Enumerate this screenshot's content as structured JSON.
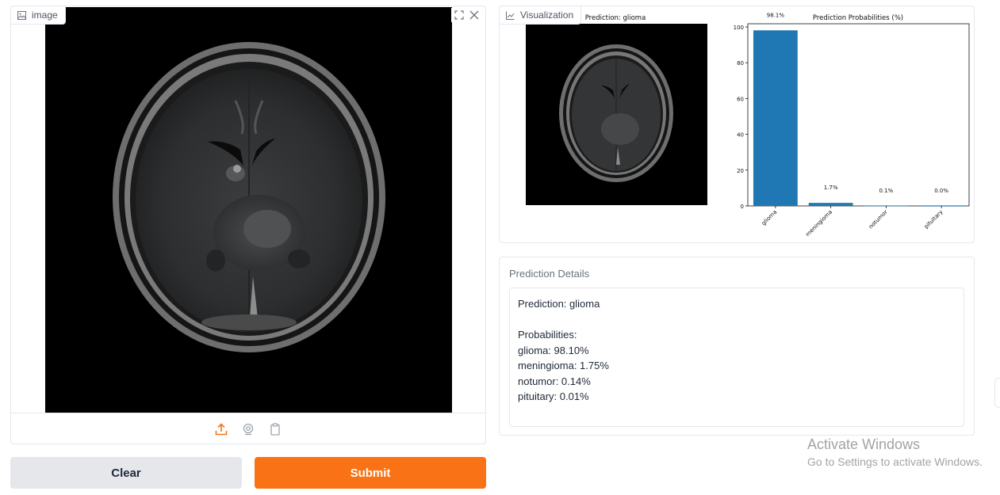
{
  "image_input": {
    "label": "image",
    "icon": "image-icon",
    "toolbar_icons": [
      "upload-icon",
      "webcam-icon",
      "clipboard-icon"
    ],
    "corner_icons": [
      "fullscreen-icon",
      "close-icon"
    ],
    "accent_color": "#f97316"
  },
  "buttons": {
    "clear": "Clear",
    "submit": "Submit"
  },
  "visualization": {
    "label": "Visualization",
    "icon": "chart-icon",
    "image_title": "Prediction: glioma"
  },
  "chart_data": {
    "type": "bar",
    "title": "Prediction Probabilities (%)",
    "categories": [
      "glioma",
      "meningioma",
      "notumor",
      "pituitary"
    ],
    "values": [
      98.1,
      1.7,
      0.1,
      0.0
    ],
    "data_labels": [
      "98.1%",
      "1.7%",
      "0.1%",
      "0.0%"
    ],
    "yticks": [
      "0",
      "20",
      "40",
      "60",
      "80",
      "100"
    ],
    "ylim": [
      0,
      100
    ],
    "bar_color": "#1f77b4",
    "grid": false
  },
  "details": {
    "label": "Prediction Details",
    "lines": [
      "Prediction: glioma",
      "",
      "Probabilities:",
      "glioma: 98.10%",
      "meningioma: 1.75%",
      "notumor: 0.14%",
      "pituitary: 0.01%"
    ]
  },
  "watermark": {
    "title": "Activate Windows",
    "subtitle": "Go to Settings to activate Windows."
  }
}
